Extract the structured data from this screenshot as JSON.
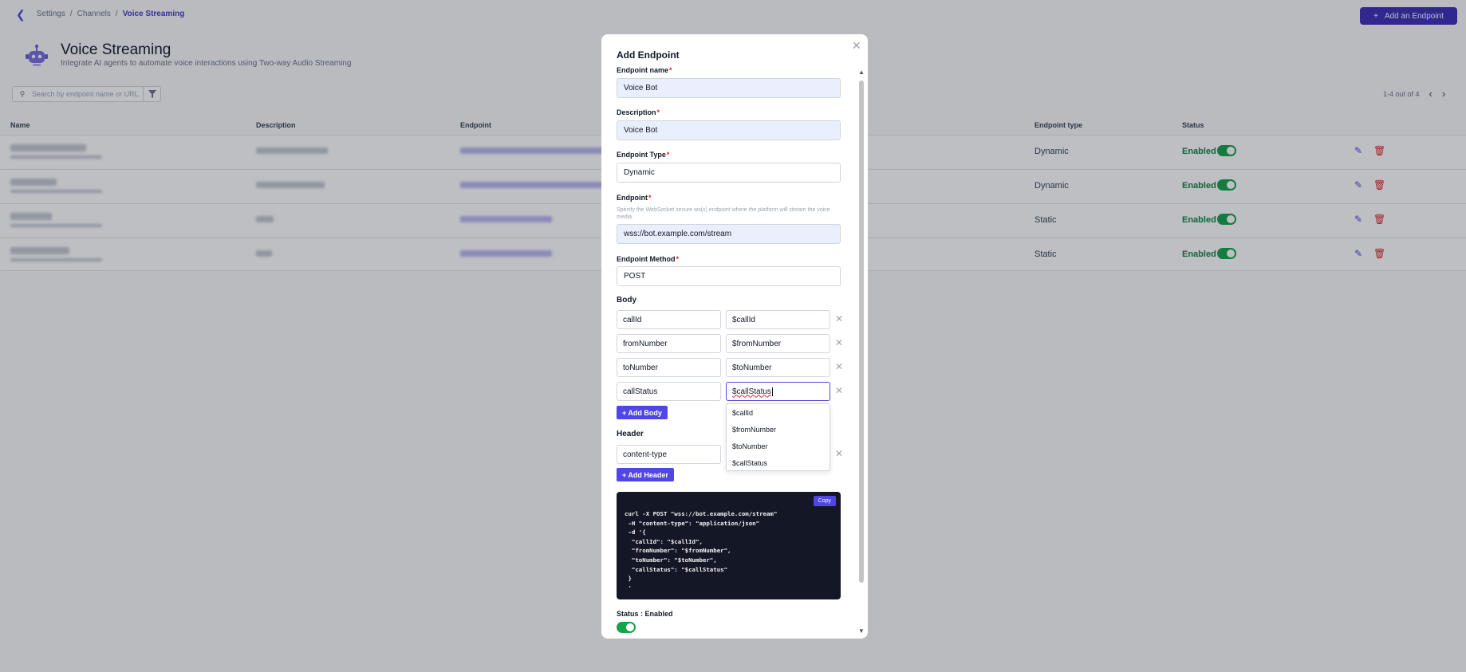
{
  "breadcrumb": {
    "items": [
      "Settings",
      "Channels"
    ],
    "current": "Voice Streaming"
  },
  "header": {
    "add_button": "Add an Endpoint",
    "title": "Voice Streaming",
    "subtitle": "Integrate AI agents to automate voice interactions using Two-way Audio Streaming"
  },
  "search": {
    "placeholder": "Search by endpoint name or URL"
  },
  "pagination": {
    "text": "1-4 out of 4"
  },
  "table": {
    "columns": [
      "Name",
      "Description",
      "Endpoint",
      "Endpoint type",
      "Status"
    ],
    "rows": [
      {
        "endpoint_type": "Dynamic",
        "status": "Enabled",
        "enabled": true
      },
      {
        "endpoint_type": "Dynamic",
        "status": "Enabled",
        "enabled": true
      },
      {
        "endpoint_type": "Static",
        "status": "Enabled",
        "enabled": true
      },
      {
        "endpoint_type": "Static",
        "status": "Enabled",
        "enabled": true
      }
    ]
  },
  "modal": {
    "title": "Add Endpoint",
    "name_label": "Endpoint name",
    "name_value": "Voice Bot",
    "description_label": "Description",
    "description_value": "Voice Bot",
    "type_label": "Endpoint Type",
    "type_value": "Dynamic",
    "endpoint_label": "Endpoint",
    "endpoint_hint": "Specify the WebSocket secure ws(s) endpoint where the platform will stream the voice media.",
    "endpoint_value": "wss://bot.example.com/stream",
    "method_label": "Endpoint Method",
    "method_value": "POST",
    "body_label": "Body",
    "body_rows": [
      {
        "key": "callId",
        "value": "$callId"
      },
      {
        "key": "fromNumber",
        "value": "$fromNumber"
      },
      {
        "key": "toNumber",
        "value": "$toNumber"
      },
      {
        "key": "callStatus",
        "value": "$callStatus"
      }
    ],
    "add_body": "+ Add Body",
    "suggestions": [
      "$callId",
      "$fromNumber",
      "$toNumber",
      "$callStatus"
    ],
    "header_label": "Header",
    "header_rows": [
      {
        "key": "content-type",
        "value": ""
      }
    ],
    "add_header": "+ Add Header",
    "copy_label": "Copy",
    "code": "curl -X POST \"wss://bot.example.com/stream\"\n -H \"content-type\": \"application/json\"\n -d '{\n  \"callId\": \"$callId\",\n  \"fromNumber\": \"$fromNumber\",\n  \"toNumber\": \"$toNumber\",\n  \"callStatus\": \"$callStatus\"\n }\n '",
    "status_label": "Status : Enabled",
    "status_enabled": true
  },
  "icons": [
    "chevron-left-icon",
    "plus-icon",
    "robot-icon",
    "search-icon",
    "filter-icon",
    "chevron-right-icon",
    "edit-icon",
    "trash-icon",
    "close-icon"
  ],
  "colors": {
    "accent": "#4f46e5",
    "success": "#16a34a",
    "danger": "#dc2626",
    "code_bg": "#141826"
  }
}
